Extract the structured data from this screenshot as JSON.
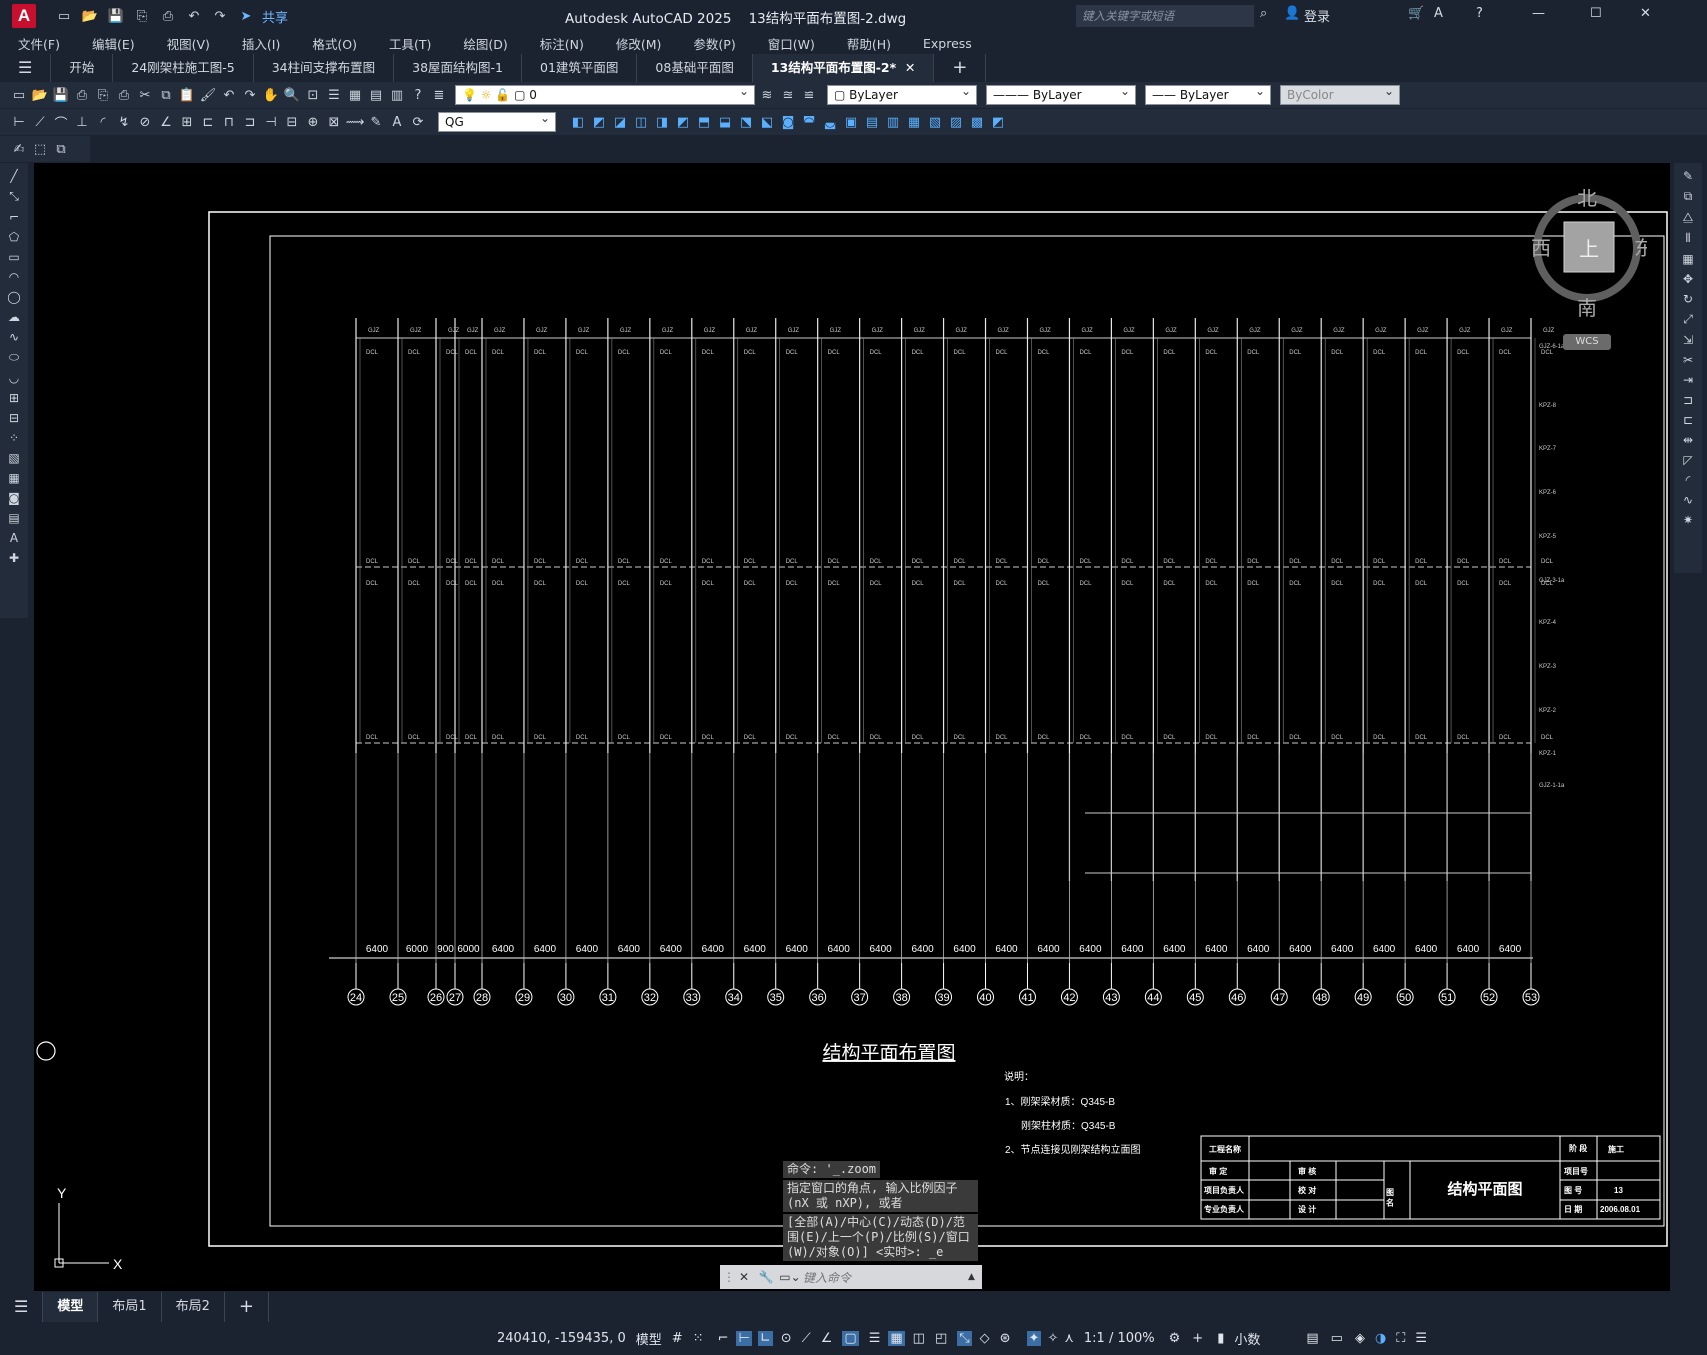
{
  "app": {
    "title": "Autodesk AutoCAD 2025",
    "document": "13结构平面布置图-2.dwg",
    "share": "共享",
    "search_placeholder": "键入关键字或短语",
    "login": "登录"
  },
  "menu": [
    "文件(F)",
    "编辑(E)",
    "视图(V)",
    "插入(I)",
    "格式(O)",
    "工具(T)",
    "绘图(D)",
    "标注(N)",
    "修改(M)",
    "参数(P)",
    "窗口(W)",
    "帮助(H)",
    "Express"
  ],
  "tabs": [
    "开始",
    "24刚架柱施工图-5",
    "34柱间支撑布置图",
    "38屋面结构图-1",
    "01建筑平面图",
    "08基础平面图",
    "13结构平面布置图-2*"
  ],
  "properties": {
    "layer": "0",
    "color": "ByLayer",
    "linetype": "ByLayer",
    "lineweight": "ByLayer",
    "plotstyle": "ByColor",
    "textstyle": "QG"
  },
  "viewcube": {
    "north": "北",
    "south": "南",
    "west": "西",
    "east": "东",
    "top": "上",
    "wcs": "WCS"
  },
  "drawing": {
    "title": "结构平面布置图",
    "notes_title": "说明：",
    "notes": [
      "1、刚架梁材质：Q345-B",
      "刚架柱材质：Q345-B",
      "2、节点连接见刚架结构立面图"
    ],
    "grid_labels": [
      "24",
      "25",
      "26",
      "27",
      "28",
      "29",
      "30",
      "31",
      "32",
      "33",
      "34",
      "35",
      "36",
      "37",
      "38",
      "39",
      "40",
      "41",
      "42",
      "43",
      "44",
      "45",
      "46",
      "47",
      "48",
      "49",
      "50",
      "51",
      "52",
      "53"
    ],
    "dimensions": [
      "6400",
      "6000",
      "900",
      "6000",
      "6400",
      "6400",
      "6400",
      "6400",
      "6400",
      "6400",
      "6400",
      "6400",
      "6400",
      "6400",
      "6400",
      "6400",
      "6400",
      "6400",
      "6400",
      "6400",
      "6400",
      "6400",
      "6400",
      "6400",
      "6400",
      "6400",
      "6400",
      "6400",
      "6400"
    ],
    "right_labels": [
      "GJZ-6-1a",
      "KPZ-8",
      "KPZ-7",
      "KPZ-6",
      "KPZ-5",
      "GJZ-3-1a",
      "KPZ-4",
      "KPZ-3",
      "KPZ-2",
      "KPZ-1",
      "GJZ-1-1a"
    ],
    "title_block": {
      "project": "工程名称",
      "stage_label": "阶 段",
      "stage": "施工",
      "review": "审 定",
      "check": "审 核",
      "pm": "项目负责人",
      "proof": "校 对",
      "proj_no": "项目号",
      "spec": "专业负责人",
      "design": "设 计",
      "drawing_no_label": "图 号",
      "drawing_no": "13",
      "date_label": "日 期",
      "date": "2006.08.01",
      "drawing_name": "结构平面图",
      "name_label": "图 名"
    }
  },
  "command": {
    "history": [
      "命令: '_.zoom",
      "指定窗口的角点, 输入比例因子 (nX 或 nXP), 或者",
      "[全部(A)/中心(C)/动态(D)/范围(E)/上一个(P)/比例(S)/窗口(W)/对象(O)] <实时>: _e"
    ],
    "placeholder": "键入命令"
  },
  "layouts": [
    "模型",
    "布局1",
    "布局2"
  ],
  "status": {
    "coords": "240410, -159435, 0",
    "model": "模型",
    "scale": "1:1 / 100%",
    "units": "小数"
  },
  "ucs": {
    "x": "X",
    "y": "Y"
  }
}
